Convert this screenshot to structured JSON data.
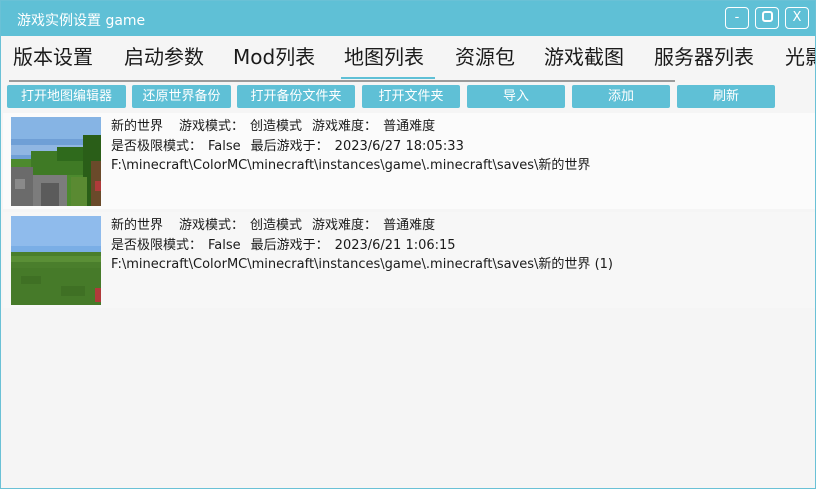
{
  "window": {
    "title": "游戏实例设置 game",
    "minimize_label": "-",
    "close_label": "X"
  },
  "tabs": [
    {
      "label": "版本设置"
    },
    {
      "label": "启动参数"
    },
    {
      "label": "Mod列表"
    },
    {
      "label": "地图列表",
      "selected": true
    },
    {
      "label": "资源包"
    },
    {
      "label": "游戏截图"
    },
    {
      "label": "服务器列表"
    },
    {
      "label": "光影"
    }
  ],
  "toolbar": {
    "open_map_editor": "打开地图编辑器",
    "restore_backup": "还原世界备份",
    "open_backup_folder": "打开备份文件夹",
    "open_folder": "打开文件夹",
    "import": "导入",
    "add": "添加",
    "refresh": "刷新"
  },
  "worlds": [
    {
      "name": "新的世界",
      "game_mode_label": "游戏模式：",
      "game_mode": "创造模式",
      "difficulty_label": "游戏难度：",
      "difficulty": "普通难度",
      "hardcore_label": "是否极限模式：",
      "hardcore": "False",
      "last_played_label": "最后游戏于：",
      "last_played": "2023/6/27 18:05:33",
      "path": "F:\\minecraft\\ColorMC\\minecraft\\instances\\game\\.minecraft\\saves\\新的世界"
    },
    {
      "name": "新的世界",
      "game_mode_label": "游戏模式：",
      "game_mode": "创造模式",
      "difficulty_label": "游戏难度：",
      "difficulty": "普通难度",
      "hardcore_label": "是否极限模式：",
      "hardcore": "False",
      "last_played_label": "最后游戏于：",
      "last_played": "2023/6/21 1:06:15",
      "path": "F:\\minecraft\\ColorMC\\minecraft\\instances\\game\\.minecraft\\saves\\新的世界 (1)"
    }
  ],
  "colors": {
    "accent": "#5fc0d6",
    "text": "#1a1a1a"
  }
}
